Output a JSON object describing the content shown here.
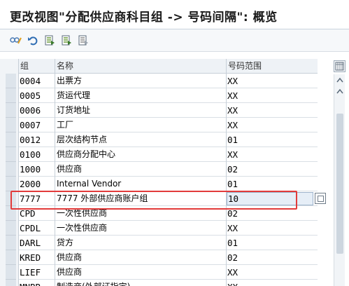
{
  "window": {
    "title": "更改视图\"分配供应商科目组 -> 号码间隔\": 概览"
  },
  "toolbar": {
    "buttons": [
      {
        "name": "display-change-icon"
      },
      {
        "name": "undo-icon"
      },
      {
        "name": "select-all-icon"
      },
      {
        "name": "select-block-icon"
      },
      {
        "name": "deselect-all-icon"
      }
    ]
  },
  "table": {
    "headers": {
      "group": "组",
      "name": "名称",
      "range": "号码范围"
    },
    "rows": [
      {
        "group": "0004",
        "name": "出票方",
        "range": "XX"
      },
      {
        "group": "0005",
        "name": "货运代理",
        "range": "XX"
      },
      {
        "group": "0006",
        "name": "订货地址",
        "range": "XX"
      },
      {
        "group": "0007",
        "name": "工厂",
        "range": "XX"
      },
      {
        "group": "0012",
        "name": "层次结构节点",
        "range": "01"
      },
      {
        "group": "0100",
        "name": "供应商分配中心",
        "range": "XX"
      },
      {
        "group": "1000",
        "name": "供应商",
        "range": "02"
      },
      {
        "group": "2000",
        "name": "Internal Vendor",
        "range": "01"
      },
      {
        "group": "7777",
        "name": "7777 外部供应商账户组",
        "range": "10"
      },
      {
        "group": "CPD",
        "name": "一次性供应商",
        "range": "02"
      },
      {
        "group": "CPDL",
        "name": "一次性供应商",
        "range": "XX"
      },
      {
        "group": "DARL",
        "name": "贷方",
        "range": "01"
      },
      {
        "group": "KRED",
        "name": "供应商",
        "range": "02"
      },
      {
        "group": "LIEF",
        "name": "供应商",
        "range": "XX"
      },
      {
        "group": "MNBR",
        "name": "制造商(外部证指定)",
        "range": "XX"
      }
    ]
  },
  "colors": {
    "highlight": "#e23b3b",
    "input_bg": "#e6eef7"
  }
}
